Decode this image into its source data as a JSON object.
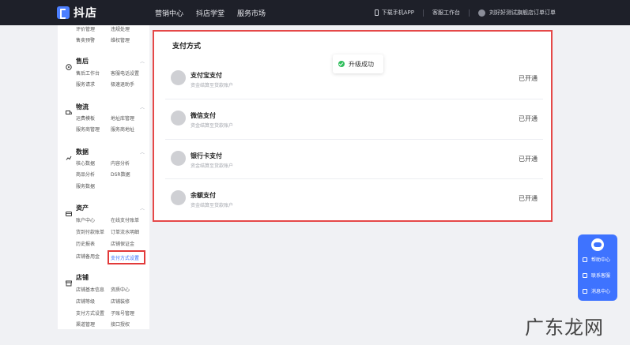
{
  "header": {
    "logo": "抖店",
    "nav": [
      "营销中心",
      "抖店学堂",
      "服务市场"
    ],
    "download_app": "下载手机APP",
    "service_desk": "客服工作台",
    "user": "刘好好测试旗舰店订单订单"
  },
  "sidebar": {
    "top_items": [
      [
        "评价管理",
        "违规处理"
      ],
      [
        "售卖预警",
        "维权管理"
      ]
    ],
    "groups": [
      {
        "title": "售后",
        "icon": "headset-icon",
        "items": [
          [
            "售后工作台",
            "客服电话设置"
          ],
          [
            "服务请求",
            "极速退助手"
          ]
        ]
      },
      {
        "title": "物流",
        "icon": "truck-icon",
        "items": [
          [
            "运费模板",
            "地址库管理"
          ],
          [
            "服务商管理",
            "服务商地址"
          ]
        ]
      },
      {
        "title": "数据",
        "icon": "chart-icon",
        "items": [
          [
            "核心数据",
            "内容分析"
          ],
          [
            "商品分析",
            "DSR数据"
          ],
          [
            "服务数据"
          ]
        ]
      },
      {
        "title": "资产",
        "icon": "wallet-icon",
        "items": [
          [
            "账户中心",
            "在线支付账单"
          ],
          [
            "货到付款账单",
            "订单流水明细"
          ],
          [
            "历史报表",
            "店铺保证金"
          ],
          [
            "店铺备用金",
            "支付方式设置"
          ]
        ]
      },
      {
        "title": "店铺",
        "icon": "store-icon",
        "items": [
          [
            "店铺基本信息",
            "资质中心"
          ],
          [
            "店铺等级",
            "店铺装修"
          ],
          [
            "支付方式设置",
            "子账号管理"
          ],
          [
            "渠道管理",
            "接口授权"
          ]
        ]
      }
    ]
  },
  "main": {
    "title": "支付方式",
    "methods": [
      {
        "name": "支付宝支付",
        "desc": "资金结算至货款账户",
        "status": "已开通"
      },
      {
        "name": "微信支付",
        "desc": "资金结算至货款账户",
        "status": "已开通"
      },
      {
        "name": "银行卡支付",
        "desc": "资金结算至货款账户",
        "status": "已开通"
      },
      {
        "name": "余额支付",
        "desc": "资金结算至货款账户",
        "status": "已开通"
      }
    ],
    "toast": "升级成功"
  },
  "help_widget": {
    "items": [
      "帮助中心",
      "联系客服",
      "消息中心"
    ]
  },
  "watermark": "广东龙网"
}
